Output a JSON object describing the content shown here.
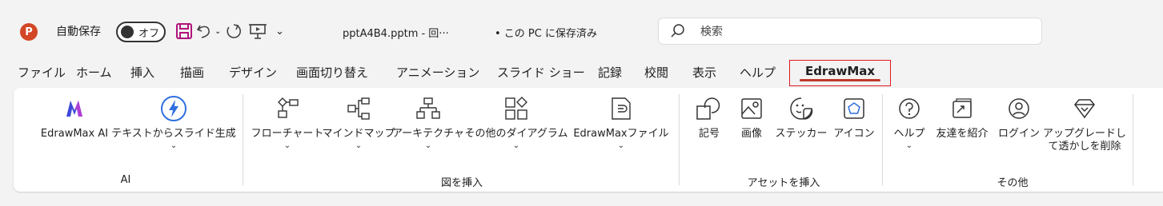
{
  "titlebar": {
    "app_icon_letter": "P",
    "autosave_label": "自動保存",
    "autosave_toggle": "オフ",
    "filename": "pptA4B4.pptm  -  回···",
    "save_state": "• この PC に保存済み",
    "search_placeholder": "検索"
  },
  "tabs": [
    "ファイル",
    "ホーム",
    "挿入",
    "描画",
    "デザイン",
    "画面切り替え",
    "アニメーション",
    "スライド ショー",
    "記録",
    "校閲",
    "表示",
    "ヘルプ"
  ],
  "active_tab": "EdrawMax",
  "ribbon": {
    "ai": {
      "label": "AI",
      "buttons": [
        "EdrawMax AI",
        "テキストからスライド生成"
      ]
    },
    "insert_figure": {
      "label": "図を挿入",
      "buttons": [
        "フローチャート",
        "マインドマップ",
        "アーキテクチャ",
        "その他のダイアグラム",
        "EdrawMaxファイル"
      ]
    },
    "insert_asset": {
      "label": "アセットを挿入",
      "buttons": [
        "記号",
        "画像",
        "ステッカー",
        "アイコン"
      ]
    },
    "other": {
      "label": "その他",
      "buttons": [
        "ヘルプ",
        "友達を紹介",
        "ログイン",
        "アップグレードし",
        "て透かしを削除"
      ]
    }
  },
  "colors": {
    "accent": "#d24726",
    "save_icon": "#b0127b",
    "ai_logo_1": "#3d4bd6",
    "ai_logo_2": "#c43bd6",
    "lightning": "#2f6fe0",
    "active_tab_border": "#e0191c"
  }
}
